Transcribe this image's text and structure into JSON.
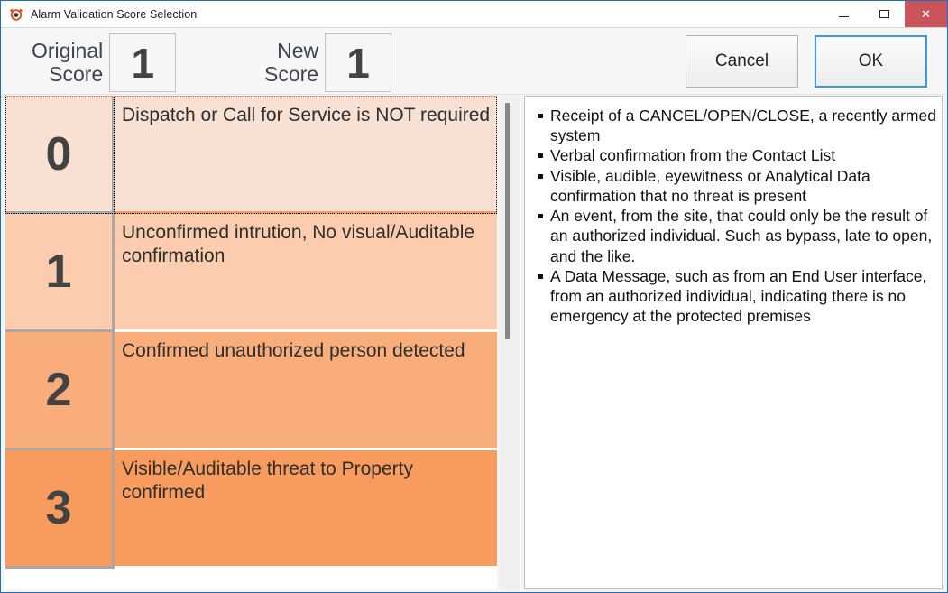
{
  "window": {
    "title": "Alarm Validation Score Selection",
    "icon": "alarm-target-icon",
    "controls": {
      "minimize": "minimize-icon",
      "maximize": "maximize-icon",
      "close": "✕"
    }
  },
  "header": {
    "original_score_label": "Original\nScore",
    "original_score_value": "1",
    "new_score_label": "New\nScore",
    "new_score_value": "1",
    "cancel_label": "Cancel",
    "ok_label": "OK"
  },
  "score_list": {
    "selected_index": 0,
    "rows": [
      {
        "score": "0",
        "description": "Dispatch or Call for Service is NOT required",
        "color": "#f8e0d2"
      },
      {
        "score": "1",
        "description": "Unconfirmed intrution, No visual/Auditable confirmation",
        "color": "#fbcdae"
      },
      {
        "score": "2",
        "description": "Confirmed unauthorized person detected",
        "color": "#f9ad7b"
      },
      {
        "score": "3",
        "description": "Visible/Auditable threat to Property confirmed",
        "color": "#f79c5e"
      }
    ]
  },
  "criteria": {
    "items": [
      "Receipt of a CANCEL/OPEN/CLOSE, a recently armed system",
      "Verbal confirmation from the Contact List",
      "Visible, audible, eyewitness or Analytical Data confirmation that no threat is present",
      "An event, from the site, that could only be the result of an authorized individual. Such as bypass, late to open, and the like.",
      "A Data Message, such as from an End User interface, from an authorized individual, indicating there is no emergency at the protected premises"
    ]
  },
  "colors": {
    "accent_blue": "#1f6fb5",
    "close_red": "#c9555a",
    "focus_blue": "#3a9adf"
  }
}
